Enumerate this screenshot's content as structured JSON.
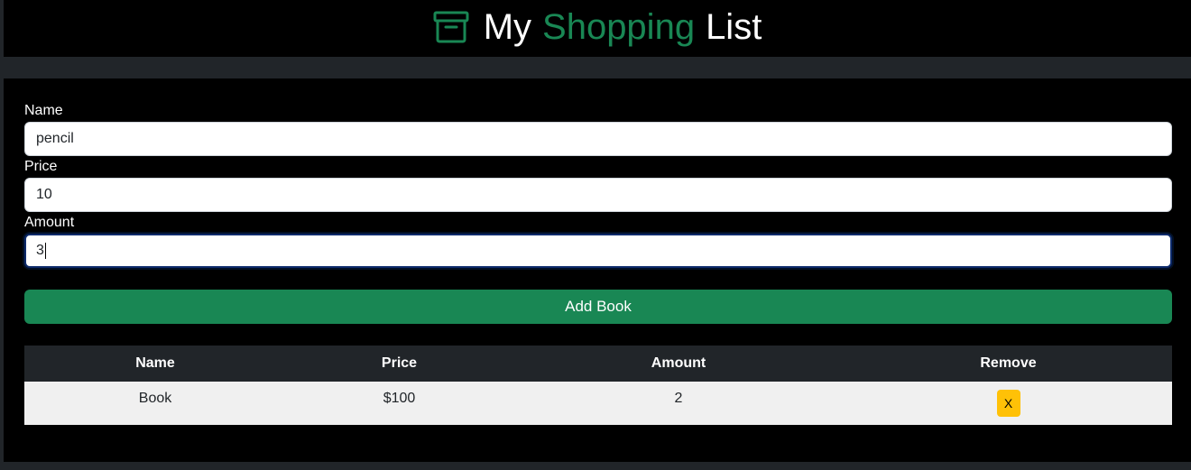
{
  "header": {
    "title_word1": "My",
    "title_word2": "Shopping",
    "title_word3": "List",
    "icon": "archive-box-icon",
    "accent_color": "#198754"
  },
  "form": {
    "name_label": "Name",
    "name_value": "pencil",
    "price_label": "Price",
    "price_value": "10",
    "amount_label": "Amount",
    "amount_value": "3",
    "submit_label": "Add Book"
  },
  "table": {
    "headers": [
      "Name",
      "Price",
      "Amount",
      "Remove"
    ],
    "rows": [
      {
        "name": "Book",
        "price": "$100",
        "amount": "2",
        "remove_label": "X"
      }
    ]
  }
}
